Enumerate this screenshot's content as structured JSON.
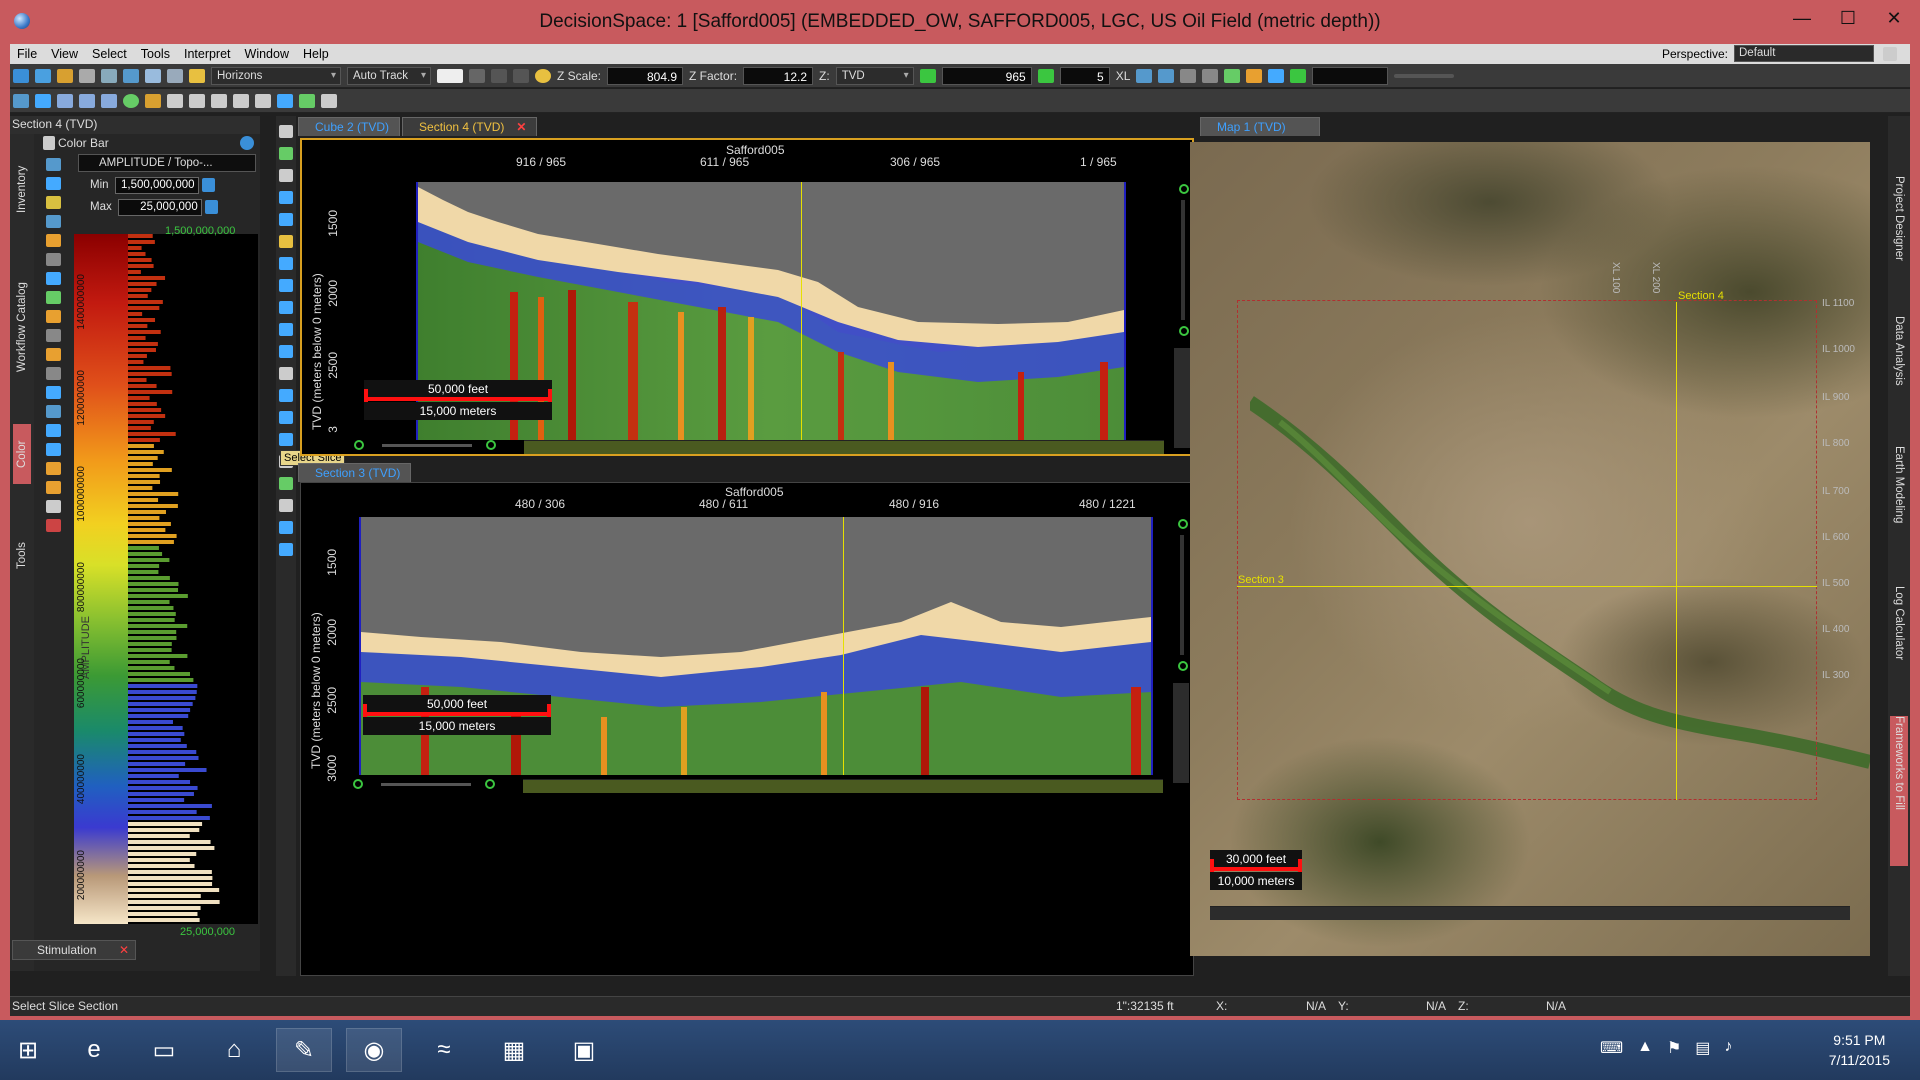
{
  "window": {
    "title": "DecisionSpace: 1 [Safford005] (EMBEDDED_OW, SAFFORD005, LGC, US Oil Field (metric depth))",
    "minimize": "—",
    "maximize": "☐",
    "close": "✕"
  },
  "menu": [
    "File",
    "View",
    "Select",
    "Tools",
    "Interpret",
    "Window",
    "Help"
  ],
  "perspective": {
    "label": "Perspective:",
    "value": "Default"
  },
  "toolbar": {
    "horizons": "Horizons",
    "auto_track": "Auto Track",
    "z_scale_label": "Z Scale:",
    "z_scale_value": "804.9",
    "z_factor_label": "Z Factor:",
    "z_factor_value": "12.2",
    "z_label": "Z:",
    "z_value": "TVD",
    "slice_value": "965",
    "step_value": "5",
    "xl_label": "XL"
  },
  "left_panel": {
    "title": "Section 4 (TVD)",
    "vtabs": [
      "Inventory",
      "Workflow Catalog",
      "Color",
      "Tools"
    ],
    "colorbar_title": "Color Bar",
    "attribute": "AMPLITUDE / Topo-...",
    "min_label": "Min",
    "min_value": "1,500,000,000",
    "max_label": "Max",
    "max_value": "25,000,000",
    "top_value": "1,500,000,000",
    "bottom_value": "25,000,000",
    "axis_label": "AMPLITUDE",
    "ticks": [
      "1400000000",
      "1200000000",
      "1000000000",
      "800000000",
      "600000000",
      "400000000",
      "200000000"
    ]
  },
  "tooltip": "Select Slice",
  "tabs_top": [
    {
      "label": "Cube 2 (TVD)",
      "active": false
    },
    {
      "label": "Section 4 (TVD)",
      "active": true,
      "close": "✕"
    }
  ],
  "section4": {
    "well": "Safford005",
    "xticks": [
      "916 / 965",
      "611 / 965",
      "306 / 965",
      "1 / 965"
    ],
    "ylabel": "TVD (meters below 0 meters)",
    "yticks": [
      "1500",
      "2000",
      "2500",
      "3"
    ],
    "scale_feet": "50,000 feet",
    "scale_meters": "15,000 meters"
  },
  "section3": {
    "tab": "Section 3 (TVD)",
    "well": "Safford005",
    "xticks": [
      "480 / 306",
      "480 / 611",
      "480 / 916",
      "480 / 1221"
    ],
    "ylabel": "TVD (meters below 0 meters)",
    "yticks": [
      "1500",
      "2000",
      "2500",
      "3000"
    ],
    "scale_feet": "50,000 feet",
    "scale_meters": "15,000 meters"
  },
  "map": {
    "tab": "Map 1 (TVD)",
    "section4_label": "Section 4",
    "section3_label": "Section 3",
    "il_labels": [
      "IL 1100",
      "IL 1000",
      "IL 900",
      "IL 800",
      "IL 700",
      "IL 600",
      "IL 500",
      "IL 400",
      "IL 300"
    ],
    "xl_labels": [
      "XL 100",
      "XL 200"
    ],
    "scale_feet": "30,000 feet",
    "scale_meters": "10,000 meters"
  },
  "right_tabs": [
    "Project Designer",
    "Data Analysis",
    "Earth Modeling",
    "Log Calculator",
    "Frameworks to Fill"
  ],
  "stimulation_tab": "Stimulation",
  "status": {
    "message": "Select Slice Section",
    "scale": "1\":32135 ft",
    "x_label": "X:",
    "x_value": "N/A",
    "y_label": "Y:",
    "y_value": "N/A",
    "z_label": "Z:",
    "z_value": "N/A"
  },
  "taskbar": {
    "time": "9:51 PM",
    "date": "7/11/2015"
  }
}
